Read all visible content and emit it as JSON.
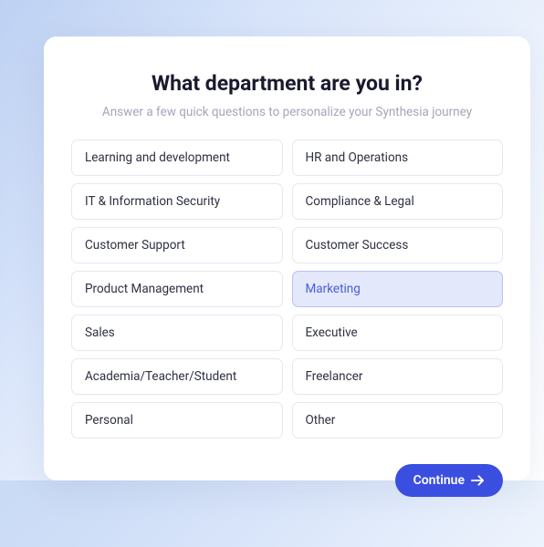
{
  "title": "What department are you in?",
  "subtitle": "Answer a few quick questions to personalize your Synthesia journey",
  "options": [
    {
      "label": "Learning and development",
      "selected": false
    },
    {
      "label": "HR and Operations",
      "selected": false
    },
    {
      "label": "IT & Information Security",
      "selected": false
    },
    {
      "label": "Compliance & Legal",
      "selected": false
    },
    {
      "label": "Customer Support",
      "selected": false
    },
    {
      "label": "Customer Success",
      "selected": false
    },
    {
      "label": "Product Management",
      "selected": false
    },
    {
      "label": "Marketing",
      "selected": true
    },
    {
      "label": "Sales",
      "selected": false
    },
    {
      "label": "Executive",
      "selected": false
    },
    {
      "label": "Academia/Teacher/Student",
      "selected": false
    },
    {
      "label": "Freelancer",
      "selected": false
    },
    {
      "label": "Personal",
      "selected": false
    },
    {
      "label": "Other",
      "selected": false
    }
  ],
  "continue_label": "Continue"
}
